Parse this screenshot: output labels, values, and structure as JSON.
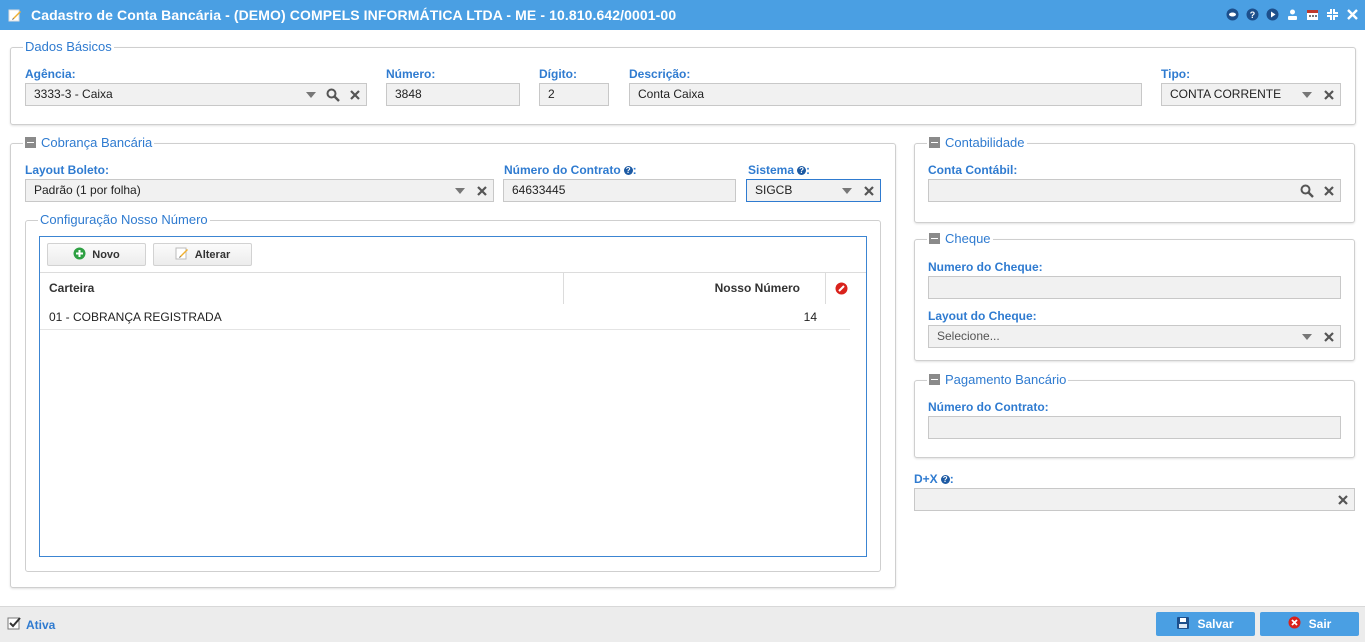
{
  "window": {
    "title": "Cadastro de Conta Bancária - (DEMO) COMPELS INFORMÁTICA LTDA - ME - 10.810.642/0001-00",
    "tools": [
      "eye-icon",
      "help-icon",
      "play-icon",
      "user-icon",
      "calendar-icon",
      "collapse-icon",
      "close-icon"
    ]
  },
  "dados_basicos": {
    "legend": "Dados Básicos",
    "agencia": {
      "label": "Agência:",
      "value": "3333-3 - Caixa"
    },
    "numero": {
      "label": "Número:",
      "value": "3848"
    },
    "digito": {
      "label": "Dígito:",
      "value": "2"
    },
    "descricao": {
      "label": "Descrição:",
      "value": "Conta Caixa"
    },
    "tipo": {
      "label": "Tipo:",
      "value": "CONTA CORRENTE"
    }
  },
  "cobranca": {
    "legend": "Cobrança Bancária",
    "layout_boleto": {
      "label": "Layout Boleto:",
      "value": "Padrão (1 por folha)"
    },
    "numero_contrato": {
      "label": "Número do Contrato",
      "value": "64633445"
    },
    "sistema": {
      "label": "Sistema",
      "value": "SIGCB"
    },
    "help_suffix": ":",
    "nosso_numero": {
      "legend": "Configuração Nosso Número",
      "novo_label": "Novo",
      "alterar_label": "Alterar",
      "columns": [
        "Carteira",
        "Nosso Número"
      ],
      "rows": [
        {
          "carteira": "01 - COBRANÇA REGISTRADA",
          "nosso_numero": "14"
        }
      ]
    }
  },
  "contabilidade": {
    "legend": "Contabilidade",
    "conta_contabil": {
      "label": "Conta Contábil:",
      "value": ""
    }
  },
  "cheque": {
    "legend": "Cheque",
    "numero_cheque": {
      "label": "Numero do Cheque:",
      "value": ""
    },
    "layout_cheque": {
      "label": "Layout do Cheque:",
      "value": "Selecione..."
    }
  },
  "pagamento": {
    "legend": "Pagamento Bancário",
    "numero_contrato": {
      "label": "Número do Contrato:",
      "value": ""
    }
  },
  "dx": {
    "label": "D+X",
    "suffix": ":",
    "value": ""
  },
  "footer": {
    "ativa_label": "Ativa",
    "salvar_label": "Salvar",
    "sair_label": "Sair"
  },
  "colors": {
    "accent": "#4a9fe3",
    "label": "#2f7bd0"
  }
}
